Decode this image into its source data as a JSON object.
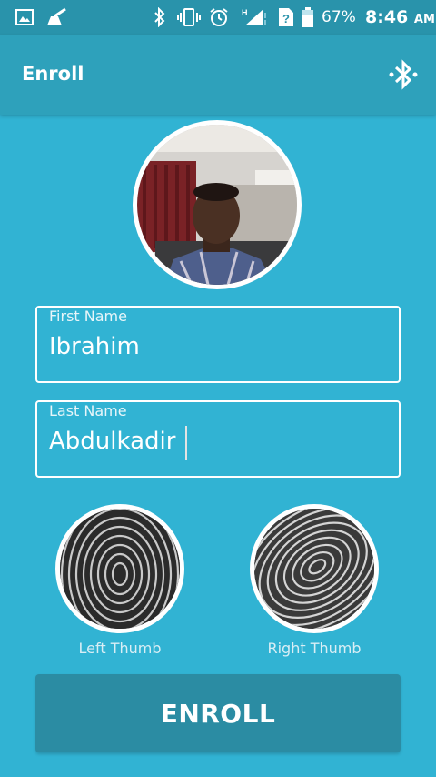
{
  "statusbar": {
    "battery": "67%",
    "time": "8:46",
    "ampm": "AM",
    "icons": [
      "image-icon",
      "cleaner-icon",
      "bluetooth-icon",
      "vibrate-icon",
      "alarm-icon",
      "signal-icon",
      "no-sim-icon",
      "battery-icon"
    ]
  },
  "toolbar": {
    "title": "Enroll",
    "action_icon": "bluetooth-searching-icon"
  },
  "form": {
    "first_name": {
      "label": "First Name",
      "value": "Ibrahim"
    },
    "last_name": {
      "label": "Last Name",
      "value": "Abdulkadir"
    }
  },
  "thumbs": {
    "left_label": "Left Thumb",
    "right_label": "Right Thumb"
  },
  "enroll_button": {
    "label": "ENROLL"
  },
  "colors": {
    "background": "#31b3d3",
    "toolbar": "#2ea1bb",
    "statusbar": "#2993ab",
    "button": "#2b8ca3"
  }
}
